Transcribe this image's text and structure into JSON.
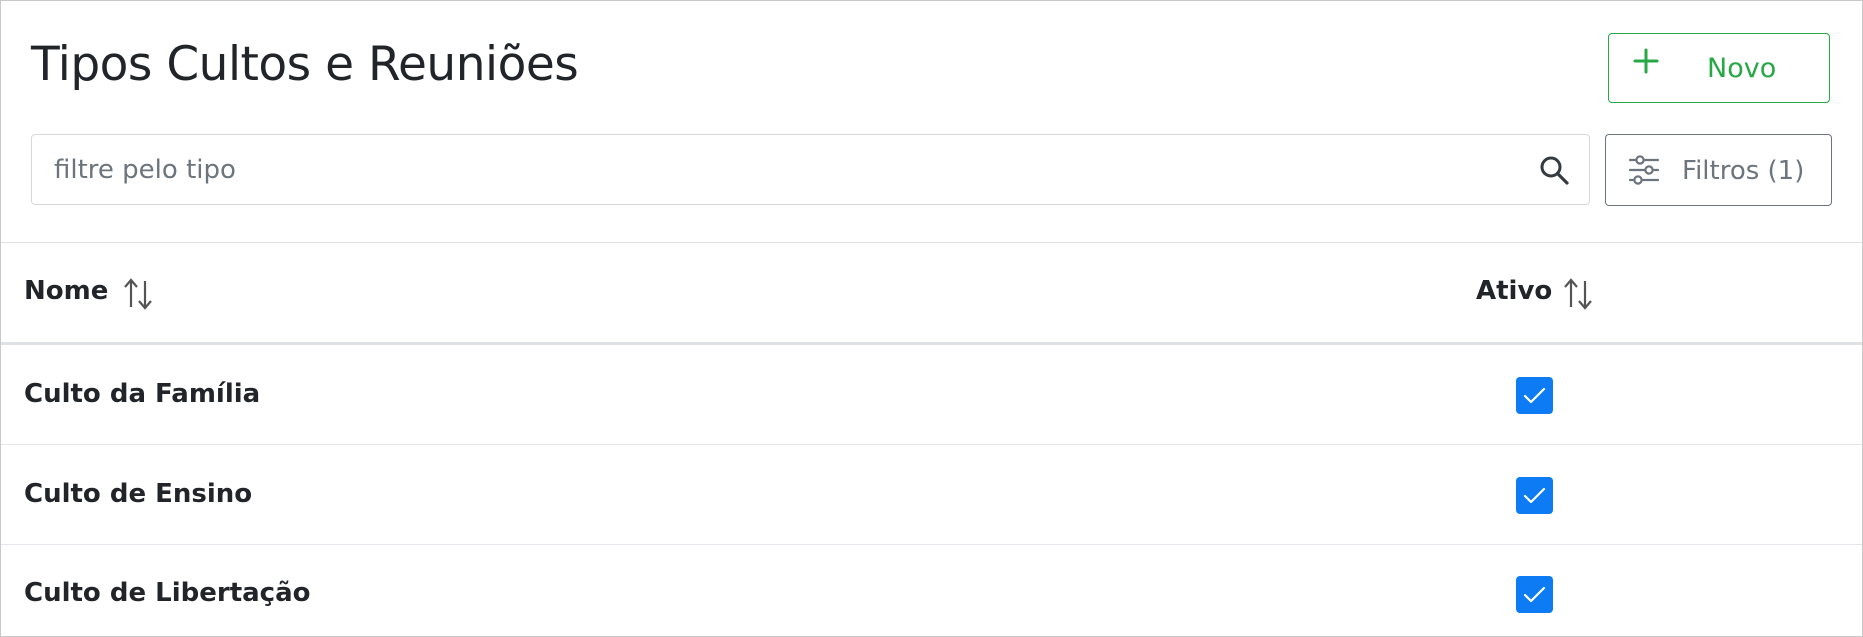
{
  "header": {
    "title": "Tipos Cultos e Reuniões",
    "new_button_label": "Novo"
  },
  "search": {
    "placeholder": "filtre pelo tipo",
    "value": ""
  },
  "filter_button": {
    "label": "Filtros (1)"
  },
  "table": {
    "columns": [
      "Nome",
      "Ativo"
    ],
    "rows": [
      {
        "name": "Culto da Família",
        "active": true
      },
      {
        "name": "Culto de Ensino",
        "active": true
      },
      {
        "name": "Culto de Libertação",
        "active": true
      }
    ]
  },
  "icons": {
    "new": "plus-icon",
    "search": "search-icon",
    "filter": "sliders-icon",
    "sort": "sort-arrows-icon",
    "check": "checkmark-icon"
  },
  "colors": {
    "success": "#28a745",
    "secondary": "#6c757d",
    "primary_checkbox": "#0d7bf3",
    "text": "#212529"
  }
}
